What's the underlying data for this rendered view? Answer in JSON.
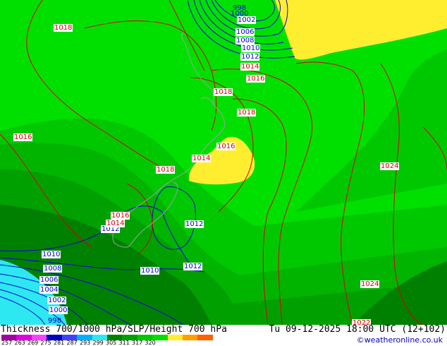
{
  "map": {
    "colors": {
      "ocean_cyan": "#2de8f0",
      "band_dark": "#008000",
      "band_mid": "#00a000",
      "band_mid2": "#00b400",
      "band_light": "#00c800",
      "band_bright": "#00e000",
      "band_yellow": "#ffee30",
      "isobar_red": "#d40000",
      "height_blue": "#0000d8",
      "coast": "#a0a0a0"
    },
    "labels": {
      "red": [
        "1018",
        "1016",
        "1014",
        "1018",
        "1018",
        "1016",
        "1016",
        "1014",
        "1018",
        "1016",
        "1014",
        "1024",
        "1024",
        "1022"
      ],
      "blue": [
        "998",
        "1000",
        "1002",
        "1006",
        "1008",
        "1010",
        "1012",
        "1012",
        "1012",
        "1010",
        "1012",
        "1010",
        "1008",
        "1006",
        "1004",
        "1002",
        "1000",
        "998"
      ]
    }
  },
  "footer": {
    "title": "Thickness 700/1000 hPa/SLP/Height 700 hPa",
    "datetime": "Tu 09-12-2025 18:00 UTC (12+102)",
    "credit": "©weatheronline.co.uk",
    "scale_values": [
      "257",
      "263",
      "269",
      "275",
      "281",
      "287",
      "293",
      "299",
      "305",
      "311",
      "317",
      "320"
    ],
    "scale_colors": [
      "#a000a0",
      "#e000e0",
      "#ff40ff",
      "#0000c0",
      "#4040ff",
      "#00b0ff",
      "#2de8f0",
      "#008000",
      "#00a000",
      "#00c800",
      "#00e000",
      "#ffee30",
      "#ffa000",
      "#ff6000"
    ]
  }
}
